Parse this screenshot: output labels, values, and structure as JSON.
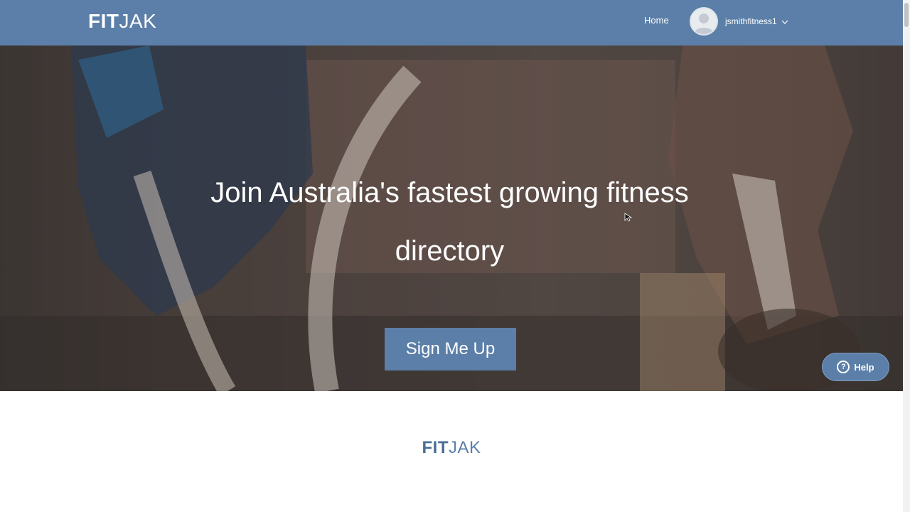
{
  "header": {
    "logo": {
      "fit": "FIT",
      "jak": "JAK"
    },
    "nav_home": "Home",
    "user": {
      "username": "jsmithfitness1"
    }
  },
  "hero": {
    "title_line1": "Join Australia's fastest growing fitness",
    "title_line2": "directory",
    "signup_label": "Sign Me Up",
    "help_label": "Help"
  },
  "footer": {
    "logo": {
      "fit": "FIT",
      "jak": "JAK"
    }
  },
  "colors": {
    "brand": "#5b7fa8",
    "hero_overlay": "#3a3431"
  },
  "icons": [
    "user-avatar-icon",
    "chevron-down-icon",
    "help-icon"
  ]
}
